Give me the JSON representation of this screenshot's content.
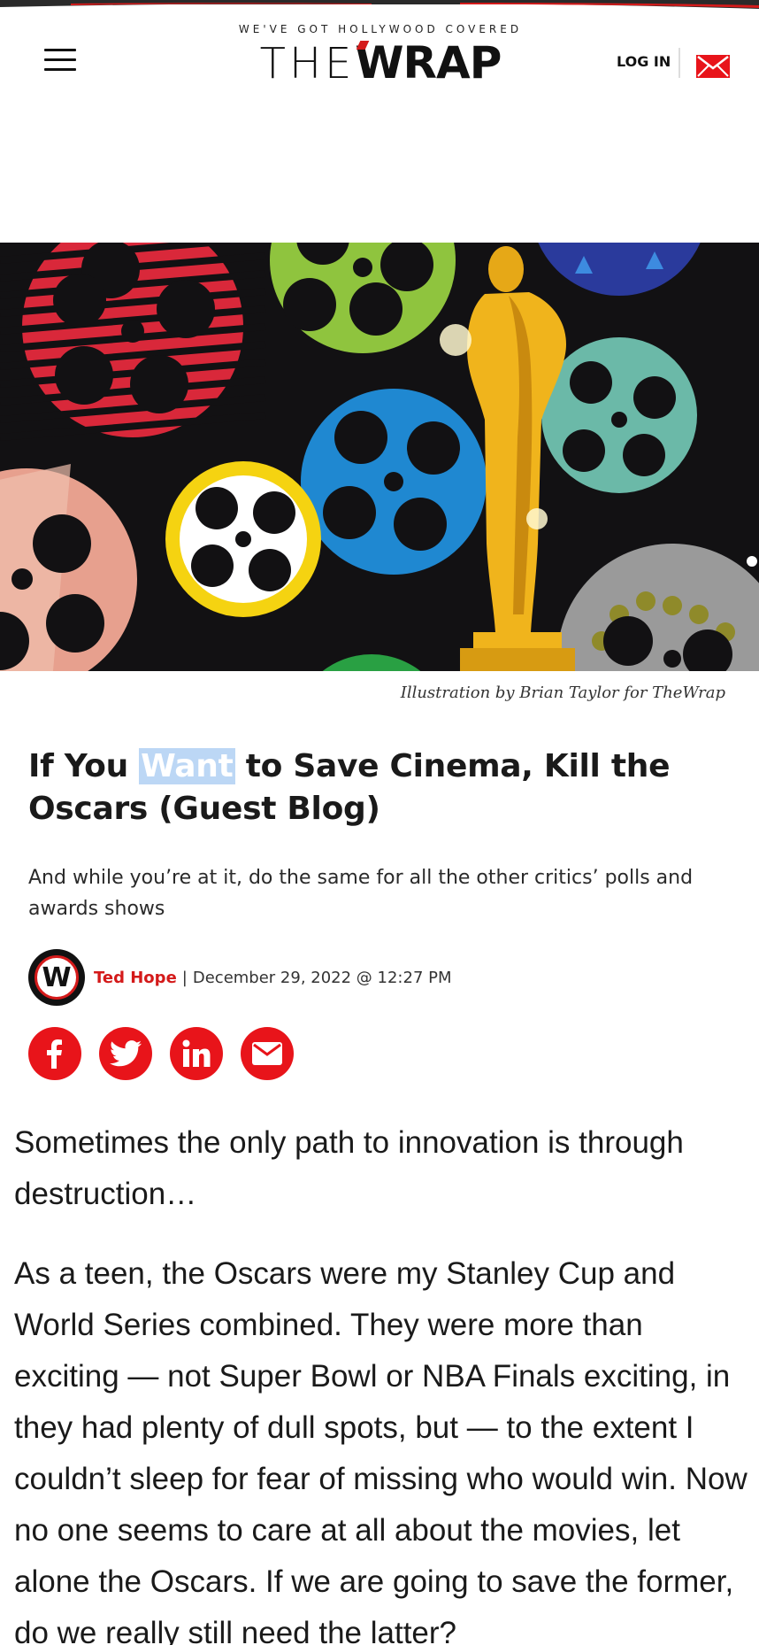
{
  "header": {
    "tagline": "WE'VE GOT HOLLYWOOD COVERED",
    "logo_the": "THE",
    "logo_wrap": "WRAP",
    "login_label": "LOG IN"
  },
  "hero": {
    "caption": "Illustration by Brian Taylor for TheWrap"
  },
  "article": {
    "headline_before": "If You ",
    "headline_highlight": "Want",
    "headline_after": " to Save Cinema, Kill the Oscars (Guest Blog)",
    "dek": "And while you’re at it, do the same for all the other critics’ polls and awards shows",
    "avatar_letter": "W",
    "author": "Ted Hope",
    "separator": "|",
    "date": "December 29, 2022 @ 12:27 PM",
    "paragraphs": [
      "Sometimes the only path to innovation is through destruction…",
      "As a teen, the Oscars were my Stanley Cup and World Series combined. They were more than exciting — not Super Bowl or NBA Finals exciting, in they had plenty of dull spots, but — to the extent I couldn’t sleep for fear of missing who would win. Now no one seems to care at all about the movies, let alone the Oscars. If we are going to save the former, do we really still need the latter?"
    ]
  },
  "share": {
    "icons": [
      "facebook-icon",
      "twitter-icon",
      "linkedin-icon",
      "email-icon"
    ]
  },
  "colors": {
    "brand_red": "#e8141a",
    "author_red": "#d41a1a",
    "highlight": "#bcd7f5",
    "hero_bg": "#121113"
  }
}
